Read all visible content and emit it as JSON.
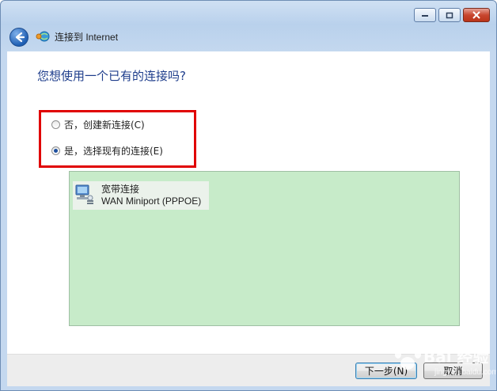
{
  "window": {
    "title": "连接到 Internet",
    "icons": {
      "minimize": "minimize-icon",
      "maximize": "maximize-icon",
      "close": "close-icon",
      "back": "back-arrow-icon",
      "network": "network-globe-icon"
    }
  },
  "main": {
    "question": "您想使用一个已有的连接吗?",
    "options": [
      {
        "label": "否，创建新连接(C)",
        "checked": false
      },
      {
        "label": "是，选择现有的连接(E)",
        "checked": true
      }
    ],
    "connections": [
      {
        "name": "宽带连接",
        "device": "WAN Miniport (PPPOE)",
        "icon": "broadband-connection-icon"
      }
    ]
  },
  "footer": {
    "next_label": "下一步(N)",
    "cancel_label": "取消"
  },
  "watermark": {
    "text": "Bai 经验",
    "sub": "jingyan.baidu.com"
  },
  "colors": {
    "highlight_box": "#e00000",
    "list_background": "#c7ebc9",
    "question_text": "#1f3e8c"
  }
}
